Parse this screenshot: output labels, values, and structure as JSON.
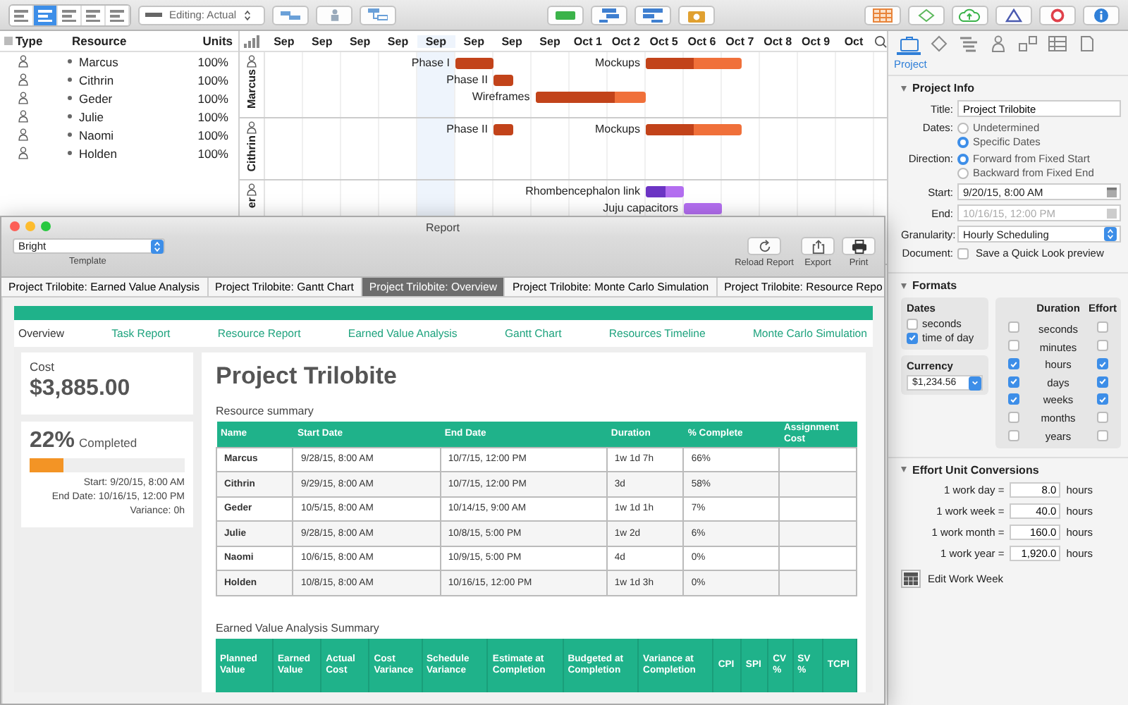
{
  "toolbar": {
    "view_modes": [
      {
        "selected": false
      },
      {
        "selected": true
      },
      {
        "selected": false
      },
      {
        "selected": false
      },
      {
        "selected": false
      }
    ],
    "editing_mode": "Editing: Actual"
  },
  "resources": {
    "columns": [
      "Type",
      "Resource",
      "Units"
    ],
    "rows": [
      {
        "name": "Marcus",
        "units": "100%"
      },
      {
        "name": "Cithrin",
        "units": "100%"
      },
      {
        "name": "Geder",
        "units": "100%"
      },
      {
        "name": "Julie",
        "units": "100%"
      },
      {
        "name": "Naomi",
        "units": "100%"
      },
      {
        "name": "Holden",
        "units": "100%"
      }
    ]
  },
  "gantt": {
    "columns": [
      {
        "label": "Sep",
        "highlighted": false
      },
      {
        "label": "Sep",
        "highlighted": false
      },
      {
        "label": "Sep",
        "highlighted": false
      },
      {
        "label": "Sep",
        "highlighted": false
      },
      {
        "label": "Sep",
        "highlighted": true
      },
      {
        "label": "Sep",
        "highlighted": false
      },
      {
        "label": "Sep",
        "highlighted": false
      },
      {
        "label": "Sep",
        "highlighted": false
      },
      {
        "label": "Oct 1",
        "highlighted": false
      },
      {
        "label": "Oct 2",
        "highlighted": false
      },
      {
        "label": "Oct 5",
        "highlighted": false
      },
      {
        "label": "Oct 6",
        "highlighted": false
      },
      {
        "label": "Oct 7",
        "highlighted": false
      },
      {
        "label": "Oct 8",
        "highlighted": false
      },
      {
        "label": "Oct 9",
        "highlighted": false
      },
      {
        "label": "Oct",
        "highlighted": false
      }
    ],
    "lanes": [
      {
        "label": "Marcus",
        "tasks": [
          {
            "name": "Phase I",
            "level": 1
          },
          {
            "name": "Phase II",
            "level": 1
          },
          {
            "name": "Wireframes",
            "level": 0.72
          },
          {
            "name": "Mockups",
            "level": 0.5
          }
        ]
      },
      {
        "label": "Cithrin",
        "tasks": [
          {
            "name": "Phase II",
            "level": 1
          },
          {
            "name": "Mockups",
            "level": 0.5
          }
        ]
      },
      {
        "label": "er",
        "tasks": [
          {
            "name": "Rhombencephalon link",
            "level": 0.5
          },
          {
            "name": "Juju capacitors",
            "level": 0
          }
        ]
      }
    ]
  },
  "inspector": {
    "tabs": [
      {
        "selected": true
      },
      {
        "selected": false
      },
      {
        "selected": false
      },
      {
        "selected": false
      },
      {
        "selected": false
      },
      {
        "selected": false
      },
      {
        "selected": false
      }
    ],
    "tab_label": "Project",
    "project_info": {
      "heading": "Project Info",
      "title_label": "Title:",
      "title": "Project Trilobite",
      "dates_label": "Dates:",
      "dates_options": [
        {
          "label": "Undetermined",
          "selected": false
        },
        {
          "label": "Specific Dates",
          "selected": true
        }
      ],
      "direction_label": "Direction:",
      "direction_options": [
        {
          "label": "Forward from Fixed Start",
          "selected": true
        },
        {
          "label": "Backward from Fixed End",
          "selected": false
        }
      ],
      "start_label": "Start:",
      "start": "9/20/15, 8:00 AM",
      "end_label": "End:",
      "end": "10/16/15, 12:00 PM",
      "end_disabled": true,
      "granularity_label": "Granularity:",
      "granularity": "Hourly Scheduling",
      "document_label": "Document:",
      "quick_look_label": "Save a Quick Look preview",
      "quick_look_checked": false
    },
    "formats": {
      "heading": "Formats",
      "dates_heading": "Dates",
      "dates": [
        {
          "label": "seconds",
          "checked": false
        },
        {
          "label": "time of day",
          "checked": true
        }
      ],
      "currency_heading": "Currency",
      "currency": "$1,234.56",
      "duration_heading": "Duration",
      "effort_heading": "Effort",
      "units": [
        {
          "label": "seconds",
          "duration": false,
          "effort": false
        },
        {
          "label": "minutes",
          "duration": false,
          "effort": false
        },
        {
          "label": "hours",
          "duration": true,
          "effort": true
        },
        {
          "label": "days",
          "duration": true,
          "effort": true
        },
        {
          "label": "weeks",
          "duration": true,
          "effort": true
        },
        {
          "label": "months",
          "duration": false,
          "effort": false
        },
        {
          "label": "years",
          "duration": false,
          "effort": false
        }
      ]
    },
    "conversions": {
      "heading": "Effort Unit Conversions",
      "rows": [
        {
          "label": "1 work day =",
          "value": "8.0",
          "unit": "hours"
        },
        {
          "label": "1 work week =",
          "value": "40.0",
          "unit": "hours"
        },
        {
          "label": "1 work month =",
          "value": "160.0",
          "unit": "hours"
        },
        {
          "label": "1 work year =",
          "value": "1,920.0",
          "unit": "hours"
        }
      ]
    },
    "edit_work_week": "Edit Work Week"
  },
  "report": {
    "title": "Report",
    "template": "Bright",
    "template_label": "Template",
    "actions": [
      "Reload Report",
      "Export",
      "Print"
    ],
    "tabs": [
      {
        "label": "Project Trilobite: Earned Value Analysis",
        "selected": false
      },
      {
        "label": "Project Trilobite: Gantt Chart",
        "selected": false
      },
      {
        "label": "Project Trilobite: Overview",
        "selected": true
      },
      {
        "label": "Project Trilobite: Monte Carlo Simulation",
        "selected": false
      },
      {
        "label": "Project Trilobite: Resource Repo",
        "selected": false
      }
    ],
    "nav": [
      {
        "label": "Overview",
        "selected": true
      },
      {
        "label": "Task Report",
        "selected": false
      },
      {
        "label": "Resource Report",
        "selected": false
      },
      {
        "label": "Earned Value Analysis",
        "selected": false
      },
      {
        "label": "Gantt Chart",
        "selected": false
      },
      {
        "label": "Resources Timeline",
        "selected": false
      },
      {
        "label": "Monte Carlo Simulation",
        "selected": false
      }
    ],
    "cost_label": "Cost",
    "cost": "$3,885.00",
    "percent": "22%",
    "completed_label": "Completed",
    "level": 0.22,
    "dates": [
      "Start: 9/20/15, 8:00 AM",
      "End Date: 10/16/15, 12:00 PM",
      "Variance: 0h"
    ],
    "project_title": "Project Trilobite",
    "resource_summary": {
      "title": "Resource summary",
      "columns": [
        "Name",
        "Start Date",
        "End Date",
        "Duration",
        "% Complete",
        "Assignment Cost"
      ],
      "rows": [
        [
          "Marcus",
          "9/28/15, 8:00 AM",
          "10/7/15, 12:00 PM",
          "1w 1d 7h",
          "66%"
        ],
        [
          "Cithrin",
          "9/29/15, 8:00 AM",
          "10/7/15, 12:00 PM",
          "3d",
          "58%"
        ],
        [
          "Geder",
          "10/5/15, 8:00 AM",
          "10/14/15, 9:00 AM",
          "1w 1d 1h",
          "7%"
        ],
        [
          "Julie",
          "9/28/15, 8:00 AM",
          "10/8/15, 5:00 PM",
          "1w 2d",
          "6%"
        ],
        [
          "Naomi",
          "10/6/15, 8:00 AM",
          "10/9/15, 5:00 PM",
          "4d",
          "0%"
        ],
        [
          "Holden",
          "10/8/15, 8:00 AM",
          "10/16/15, 12:00 PM",
          "1w 1d 3h",
          "0%"
        ]
      ]
    },
    "eva_summary": {
      "title": "Earned Value Analysis Summary",
      "columns": [
        "Planned Value",
        "Earned Value",
        "Actual Cost",
        "Cost Variance",
        "Schedule Variance",
        "Estimate at Completion",
        "Budgeted at Completion",
        "Variance at Completion",
        "CPI",
        "SPI",
        "CV %",
        "SV %",
        "TCPI"
      ]
    }
  }
}
